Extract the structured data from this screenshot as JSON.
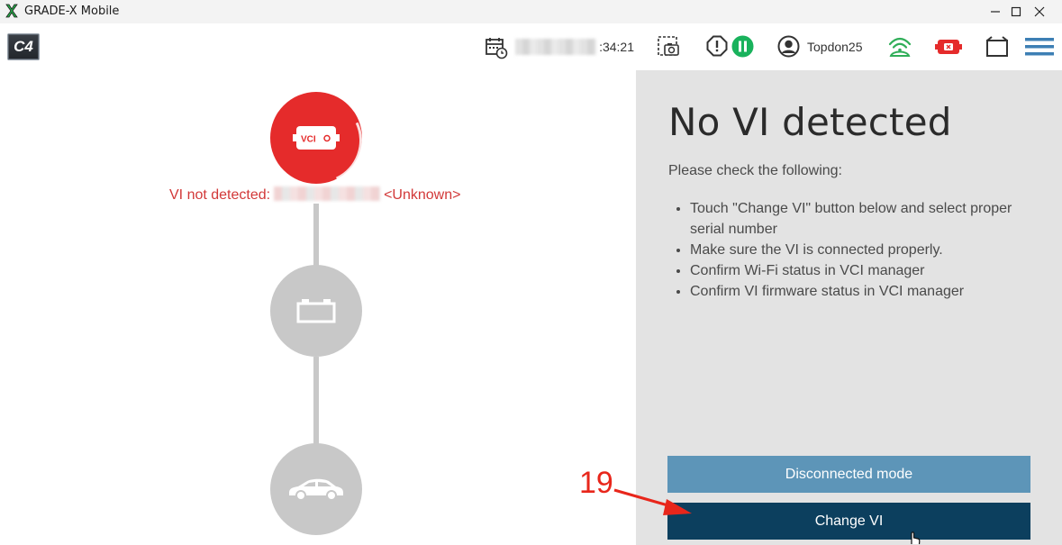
{
  "window": {
    "title": "GRADE-X Mobile",
    "controls": [
      "minimize",
      "maximize",
      "close"
    ]
  },
  "toolbar": {
    "logo_text": "C4",
    "clock_time": ":34:21",
    "user_name": "Topdon25",
    "icons": [
      "calendar-clock-icon",
      "screenshot-icon",
      "alert-icon",
      "pause-icon",
      "user-icon",
      "wifi-signal-icon",
      "vci-status-icon",
      "window-icon",
      "menu-icon"
    ],
    "colors": {
      "pause": "#19b25c",
      "wifi": "#2fae58",
      "vci_error": "#e52b2b"
    }
  },
  "left": {
    "vi_node_label": "VCI",
    "vi_status_prefix": "VI not detected:",
    "vi_status_suffix": "<Unknown>",
    "status_color": "#d23838"
  },
  "right": {
    "heading": "No VI detected",
    "subheading": "Please check the following:",
    "checklist": [
      "Touch \"Change VI\" button below and select proper serial number",
      "Make sure the VI is connected properly.",
      "Confirm Wi-Fi status in VCI manager",
      "Confirm VI firmware status in VCI manager"
    ],
    "disconnected_label": "Disconnected mode",
    "change_label": "Change VI"
  },
  "annotation": {
    "step_number": "19",
    "color": "#e8261b"
  }
}
